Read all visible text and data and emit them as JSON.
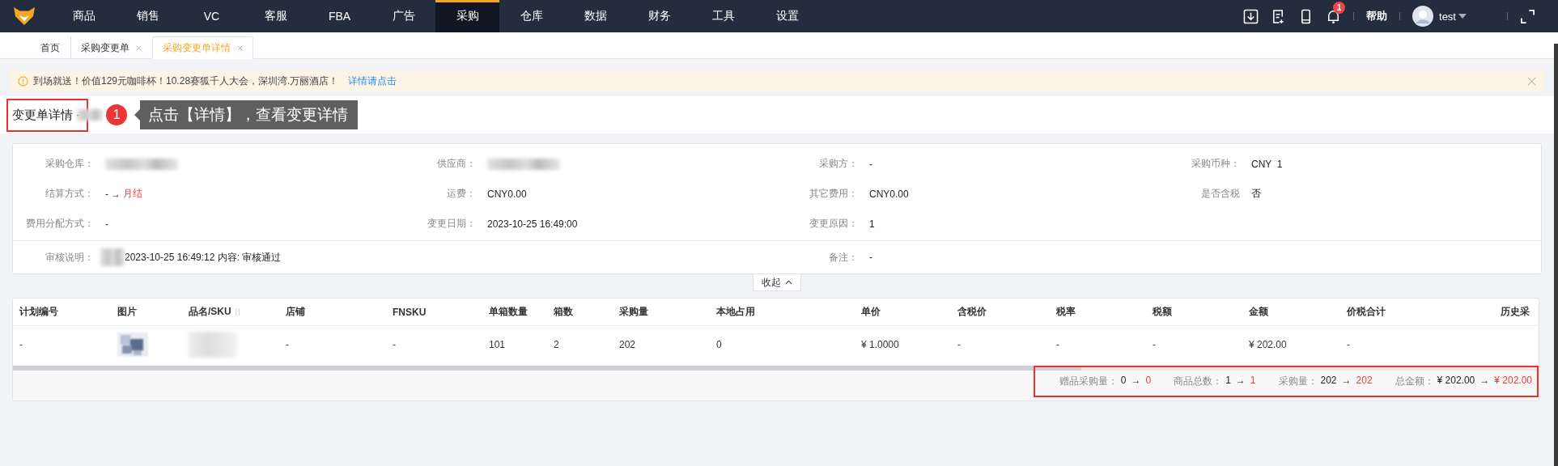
{
  "nav": {
    "items": [
      {
        "label": "商品",
        "selected": false
      },
      {
        "label": "销售",
        "selected": false
      },
      {
        "label": "VC",
        "selected": false
      },
      {
        "label": "客服",
        "selected": false
      },
      {
        "label": "FBA",
        "selected": false
      },
      {
        "label": "广告",
        "selected": false
      },
      {
        "label": "采购",
        "selected": true
      },
      {
        "label": "仓库",
        "selected": false
      },
      {
        "label": "数据",
        "selected": false
      },
      {
        "label": "财务",
        "selected": false
      },
      {
        "label": "工具",
        "selected": false
      },
      {
        "label": "设置",
        "selected": false
      }
    ],
    "notification_count": "1",
    "help": "帮助",
    "user": "test"
  },
  "tabs": [
    {
      "label": "首页",
      "selected": false,
      "closable": false
    },
    {
      "label": "采购变更单",
      "selected": false,
      "closable": true
    },
    {
      "label": "采购变更单详情",
      "selected": true,
      "closable": true
    }
  ],
  "banner": {
    "text": "到场就送！价值129元咖啡杯！10.28赛狐千人大会，深圳湾.万丽酒店！",
    "link": "详情请点击"
  },
  "title": {
    "text": "变更单详情 -",
    "highlighted": true
  },
  "tooltip": {
    "step": "1",
    "text": "点击【详情】，查看变更详情"
  },
  "details": {
    "rows": [
      [
        {
          "label": "采购仓库：",
          "kind": "redacted"
        },
        {
          "label": "供应商：",
          "kind": "redacted"
        },
        {
          "label": "采购方：",
          "kind": "plain",
          "value": "-"
        },
        {
          "label": "采购币种：",
          "kind": "plain",
          "value": "CNY  1"
        }
      ],
      [
        {
          "label": "结算方式：",
          "kind": "change",
          "old": "-",
          "arrow": "→",
          "new": "月结"
        },
        {
          "label": "运费：",
          "kind": "plain",
          "value": "CNY0.00"
        },
        {
          "label": "其它费用：",
          "kind": "plain",
          "value": "CNY0.00"
        },
        {
          "label": "是否含税",
          "kind": "plain",
          "value": "否"
        }
      ],
      [
        {
          "label": "费用分配方式：",
          "kind": "plain",
          "value": "-"
        },
        {
          "label": "变更日期：",
          "kind": "plain",
          "value": "2023-10-25 16:49:00"
        },
        {
          "label": "变更原因：",
          "kind": "plain",
          "value": "1"
        }
      ]
    ],
    "review": [
      {
        "label": "审核说明：",
        "kind": "redacted_prefix",
        "value": "2023-10-25 16:49:12 内容: 审核通过"
      },
      {
        "label": "备注：",
        "kind": "plain",
        "value": "-"
      }
    ]
  },
  "collapse": "收起",
  "table": {
    "columns": [
      "计划编号",
      "图片",
      "品名/SKU",
      "店铺",
      "FNSKU",
      "单箱数量",
      "箱数",
      "采购量",
      "本地占用",
      "单价",
      "含税价",
      "税率",
      "税额",
      "金额",
      "价税合计",
      "历史采"
    ],
    "rows": [
      [
        {
          "kind": "text",
          "text": "-"
        },
        {
          "kind": "picture"
        },
        {
          "kind": "redacted"
        },
        {
          "kind": "text",
          "text": "-"
        },
        {
          "kind": "text",
          "text": "-"
        },
        {
          "kind": "text",
          "text": "101"
        },
        {
          "kind": "text",
          "text": "2"
        },
        {
          "kind": "text",
          "text": "202"
        },
        {
          "kind": "text",
          "text": "0"
        },
        {
          "kind": "text",
          "text": "¥ 1.0000"
        },
        {
          "kind": "text",
          "text": "-"
        },
        {
          "kind": "text",
          "text": "-"
        },
        {
          "kind": "text",
          "text": "-"
        },
        {
          "kind": "text",
          "text": "¥ 202.00"
        },
        {
          "kind": "text",
          "text": "-"
        }
      ]
    ]
  },
  "summary": {
    "highlighted": true,
    "items": [
      {
        "label": "赠品采购量：",
        "old": "0",
        "arrow": "→",
        "new": "0"
      },
      {
        "label": "商品总数：",
        "old": "1",
        "arrow": "→",
        "new": "1"
      },
      {
        "label": "采购量：",
        "old": "202",
        "arrow": "→",
        "new": "202"
      },
      {
        "label": "总金额：",
        "old": "¥ 202.00",
        "arrow": "→",
        "new": "¥ 202.00"
      }
    ]
  }
}
